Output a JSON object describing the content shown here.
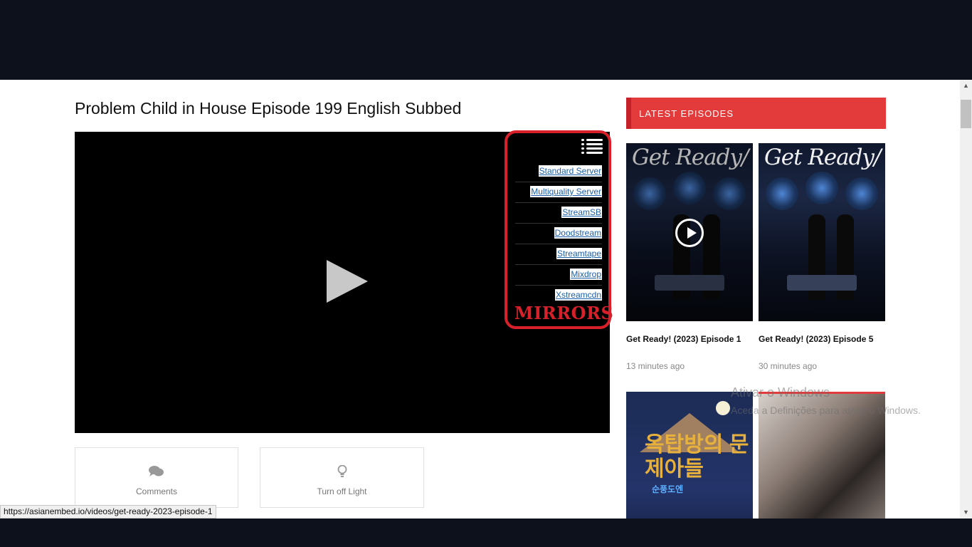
{
  "page": {
    "title": "Problem Child in House Episode 199 English Subbed"
  },
  "player": {
    "mirrors_label": "MIRRORS",
    "servers": [
      "Standard Server",
      "Multiquality Server",
      "StreamSB",
      "Doodstream",
      "Streamtape",
      "Mixdrop",
      "Xstreamcdn"
    ]
  },
  "actions": {
    "comments_label": "Comments",
    "light_label": "Turn off Light"
  },
  "sidebar": {
    "header": "LATEST EPISODES",
    "episodes": [
      {
        "title": "Get Ready! (2023) Episode 1",
        "time": "13 minutes ago",
        "poster_text": "Get Ready/"
      },
      {
        "title": "Get Ready! (2023) Episode 5",
        "time": "30 minutes ago",
        "poster_text": "Get Ready/"
      },
      {
        "poster_title": "옥탑방의 문제아들",
        "poster_sub": "순풍도엔"
      }
    ]
  },
  "overlay": {
    "watermark_line1": "Ativar o Windows",
    "watermark_line2": "Aceda a Definições para ativar o Windows."
  },
  "status_bar": {
    "url": "https://asianembed.io/videos/get-ready-2023-episode-1"
  },
  "colors": {
    "accent": "#e33b3b",
    "mirror_border": "#d8202b",
    "link": "#1b5fa8"
  }
}
